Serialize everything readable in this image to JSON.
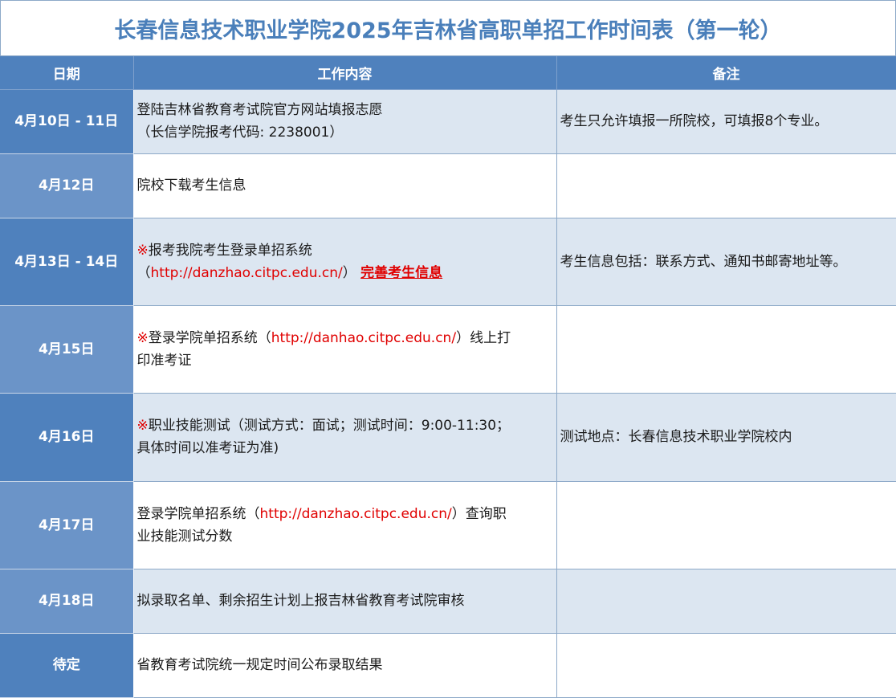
{
  "title": "长春信息技术职业学院2025年吉林省高职单招工作时间表（第一轮）",
  "headers": {
    "date": "日期",
    "content": "工作内容",
    "note": "备注"
  },
  "colors": {
    "title_text": "#4a7fba",
    "header_bg": "#4f81bd",
    "date_dark": "#4f81bd",
    "date_light": "#6b94c8",
    "row_shade": "#dce6f1",
    "highlight": "#e00000"
  },
  "rows": [
    {
      "date": "4月10日 - 11日",
      "content_line1": "登陆吉林省教育考试院官方网站填报志愿",
      "content_line2": "（长信学院报考代码: 2238001）",
      "note": "考生只允许填报一所院校，可填报8个专业。"
    },
    {
      "date": "4月12日",
      "content": "院校下载考生信息",
      "note": ""
    },
    {
      "date": "4月13日 - 14日",
      "mark": "※",
      "content_line1": "报考我院考生登录单招系统",
      "paren_open": "（",
      "link": "http://danzhao.citpc.edu.cn/",
      "paren_close": "）",
      "strong_link": "完善考生信息",
      "note": "考生信息包括：联系方式、通知书邮寄地址等。"
    },
    {
      "date": "4月15日",
      "mark": "※",
      "content_pre": "登录学院单招系统（",
      "link": "http://danhao.citpc.edu.cn/",
      "content_post": "）线上打",
      "content_line2": "印准考证",
      "note": ""
    },
    {
      "date": "4月16日",
      "mark": "※",
      "content_line1": "职业技能测试（测试方式：面试；测试时间：9:00-11:30；",
      "content_line2": "具体时间以准考证为准)",
      "note": "测试地点：长春信息技术职业学院校内"
    },
    {
      "date": "4月17日",
      "content_pre": "登录学院单招系统（",
      "link": "http://danzhao.citpc.edu.cn/",
      "content_post": "）查询职",
      "content_line2": "业技能测试分数",
      "note": ""
    },
    {
      "date": "4月18日",
      "content": "拟录取名单、剩余招生计划上报吉林省教育考试院审核",
      "note": ""
    },
    {
      "date": "待定",
      "content": "省教育考试院统一规定时间公布录取结果",
      "note": ""
    }
  ]
}
